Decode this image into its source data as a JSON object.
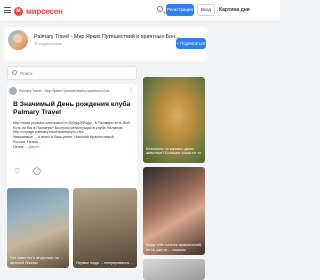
{
  "header": {
    "logo_text": "мирсесен",
    "register_label": "Регистрация",
    "login_label": "Вход",
    "right_title": "Картина дня"
  },
  "channel": {
    "name": "Palmary Travel - Мир Ярких Путешествий и приятных Бон...",
    "subscribers": "30 подписчиков",
    "subscribe_label": "+ Подписаться"
  },
  "search": {
    "placeholder": "Поиск"
  },
  "post": {
    "source": "Palmary Travel - Мир Ярких Путешествий и приятных Бон...",
    "title": "В Значимый День рождения клуба Palmary Travel",
    "body_lines": [
      "http://www.youtube.com/watch?v=5Xdyg2j9Ngw - в Палмери есть Все!",
      "Есть ли Вы в Палмери? Быстрая регистрация в клубе Палмери:",
      "http://voyage.palmary.travel/palmary/ru.htm",
      "Уважаемые ... и всего в Ваш успех, Николай Красноглазый",
      "Россия. Пенза.",
      "Пенза ..."
    ],
    "more_label": "Далее"
  },
  "thumbs": [
    {
      "caption": "Что известно о веществах на ... жителей Японии"
    },
    {
      "caption": "Первые люди ... генерировался ..."
    }
  ],
  "side": [
    {
      "caption": "Безопасно ли кормить диких животных? Большие кошки не то ..."
    },
    {
      "caption": "Когда тебе хочется приключений, но ты уже не ... мышьяк"
    }
  ],
  "icons": {
    "menu": "menu-icon",
    "search": "search-icon",
    "like": "heart-icon",
    "comment": "comment-icon",
    "more": "more-icon"
  },
  "colors": {
    "brand": "#e8473f",
    "accent": "#2f80ed"
  }
}
